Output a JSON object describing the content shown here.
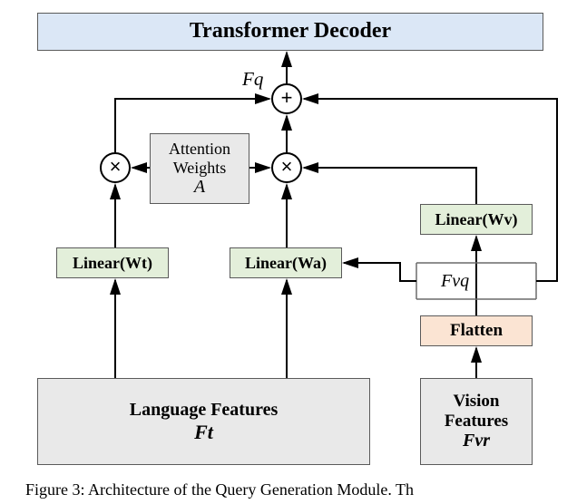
{
  "decoder": {
    "label": "Transformer Decoder"
  },
  "attention_weights": {
    "line1": "Attention",
    "line2": "Weights",
    "symbol": "A"
  },
  "linear": {
    "wt": "Linear(Wt)",
    "wa": "Linear(Wa)",
    "wv": "Linear(Wv)"
  },
  "flatten": {
    "label": "Flatten"
  },
  "lang_features": {
    "line1": "Language Features",
    "symbol": "Ft"
  },
  "vision_features": {
    "line1": "Vision",
    "line2": "Features",
    "symbol": "Fvr"
  },
  "labels": {
    "Fq": "Fq",
    "Fvq": "Fvq"
  },
  "caption": "Figure 3: Architecture of the Query Generation Module.  Th",
  "chart_data": {
    "type": "diagram",
    "nodes": [
      {
        "id": "lang",
        "label": "Language Features Ft"
      },
      {
        "id": "vision",
        "label": "Vision Features Fvr"
      },
      {
        "id": "flatten",
        "label": "Flatten"
      },
      {
        "id": "fvq",
        "label": "Fvq"
      },
      {
        "id": "lin_wt",
        "label": "Linear(Wt)"
      },
      {
        "id": "lin_wa",
        "label": "Linear(Wa)"
      },
      {
        "id": "lin_wv",
        "label": "Linear(Wv)"
      },
      {
        "id": "mul1",
        "op": "multiply"
      },
      {
        "id": "mul2",
        "op": "multiply"
      },
      {
        "id": "attn",
        "label": "Attention Weights A"
      },
      {
        "id": "add",
        "op": "add",
        "out_label": "Fq"
      },
      {
        "id": "decoder",
        "label": "Transformer Decoder"
      }
    ],
    "edges": [
      [
        "lang",
        "lin_wt"
      ],
      [
        "lang",
        "lin_wa"
      ],
      [
        "vision",
        "flatten"
      ],
      [
        "flatten",
        "fvq"
      ],
      [
        "fvq",
        "lin_wa"
      ],
      [
        "fvq",
        "lin_wv"
      ],
      [
        "fvq",
        "add"
      ],
      [
        "lin_wt",
        "mul1"
      ],
      [
        "lin_wa",
        "mul2"
      ],
      [
        "lin_wv",
        "add"
      ],
      [
        "attn",
        "mul1"
      ],
      [
        "attn",
        "mul2"
      ],
      [
        "mul1",
        "add"
      ],
      [
        "mul2",
        "add"
      ],
      [
        "add",
        "decoder"
      ]
    ]
  }
}
